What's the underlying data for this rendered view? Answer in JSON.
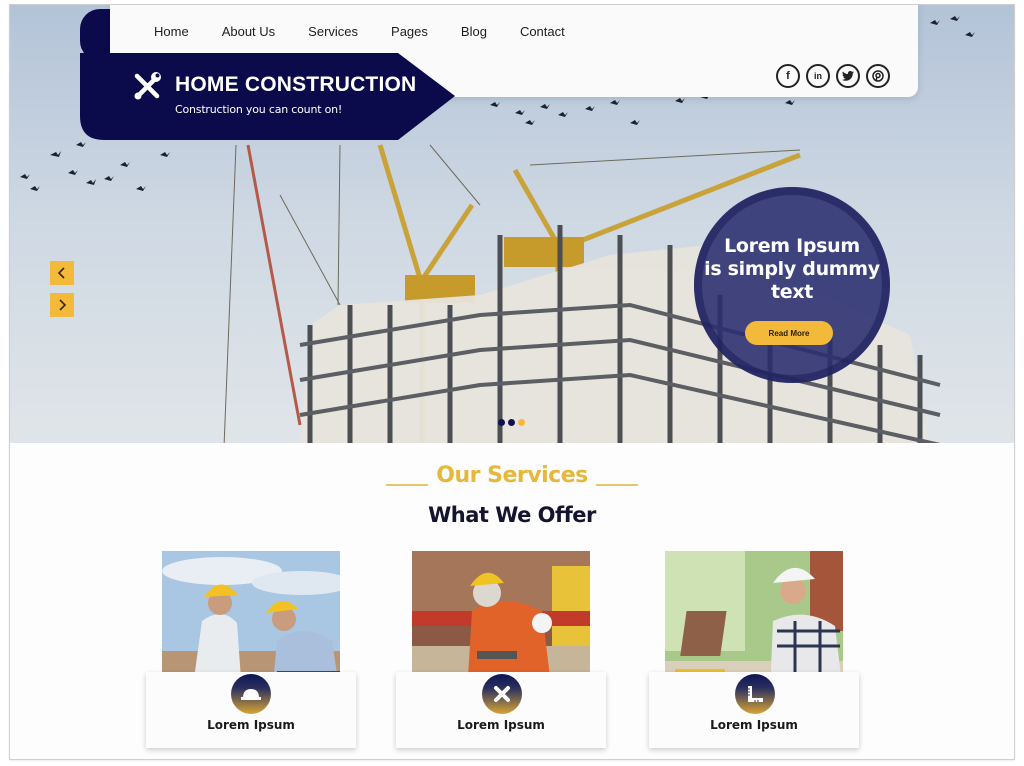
{
  "brand": {
    "title": "HOME CONSTRUCTION",
    "tagline": "Construction you can count on!",
    "logo_icon": "tools-cross-icon",
    "color": "#0b0b4b"
  },
  "nav": {
    "items": [
      {
        "label": "Home"
      },
      {
        "label": "About Us"
      },
      {
        "label": "Services"
      },
      {
        "label": "Pages"
      },
      {
        "label": "Blog"
      },
      {
        "label": "Contact"
      }
    ]
  },
  "social": [
    {
      "name": "facebook-icon",
      "glyph": "f"
    },
    {
      "name": "linkedin-icon",
      "glyph": "in"
    },
    {
      "name": "twitter-icon",
      "glyph": "🐦"
    },
    {
      "name": "pinterest-icon",
      "glyph": "℗"
    }
  ],
  "hero": {
    "callout_text": "Lorem Ipsum is simply dummy text",
    "button_label": "Read More",
    "prev_icon": "chevron-left-icon",
    "next_icon": "chevron-right-icon",
    "slides": [
      {
        "active": false,
        "color": "#0d1255"
      },
      {
        "active": false,
        "color": "#0d1255"
      },
      {
        "active": true,
        "color": "#f2b93b"
      }
    ]
  },
  "services": {
    "eyebrow": "Our Services",
    "title": "What We Offer",
    "cards": [
      {
        "label": "Lorem Ipsum",
        "icon": "hard-hat-icon",
        "image": "workers-with-hard-hats"
      },
      {
        "label": "Lorem Ipsum",
        "icon": "ruler-pencil-cross-icon",
        "image": "welder-in-orange-suit"
      },
      {
        "label": "Lorem Ipsum",
        "icon": "set-square-ruler-icon",
        "image": "engineer-with-laptop"
      }
    ]
  },
  "colors": {
    "accent": "#f2b93b",
    "primary": "#0b0b4b",
    "heading": "#14142e"
  }
}
